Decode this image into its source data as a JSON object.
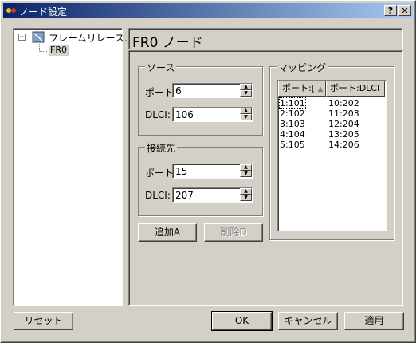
{
  "window": {
    "title": "ノード設定",
    "help_label": "?",
    "close_label": "✕"
  },
  "tree": {
    "expander": "−",
    "root_label": "フレームリレース…",
    "child_label": "FR0"
  },
  "header": {
    "title": "FR0 ノード"
  },
  "source": {
    "title": "ソース",
    "port_label": "ポート:",
    "port_value": "6",
    "dlci_label": "DLCI:",
    "dlci_value": "106"
  },
  "destination": {
    "title": "接続先",
    "port_label": "ポート:",
    "port_value": "15",
    "dlci_label": "DLCI:",
    "dlci_value": "207"
  },
  "buttons": {
    "add": "追加A",
    "delete": "削除D",
    "reset": "リセット",
    "ok": "OK",
    "cancel": "キャンセル",
    "apply": "適用"
  },
  "mapping": {
    "title": "マッピング",
    "columns": [
      "ポート:[",
      "ポート:DLCI"
    ],
    "rows": [
      [
        "1:101",
        "10:202"
      ],
      [
        "2:102",
        "11:203"
      ],
      [
        "3:103",
        "12:204"
      ],
      [
        "4:104",
        "13:205"
      ],
      [
        "5:105",
        "14:206"
      ]
    ]
  }
}
